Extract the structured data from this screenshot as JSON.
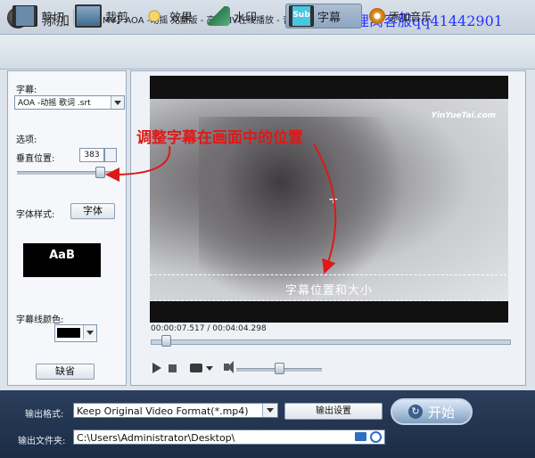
{
  "topbar": {
    "add_label": "添加",
    "file_title": "...\\【MV】AOA -动摇 完整版 - 高清MV在线播放 - 音悦Tai - 让娱乐更美好.MP4",
    "watermark": "狸窝客服qq41442901"
  },
  "tabs": [
    {
      "label": "剪切"
    },
    {
      "label": "裁剪"
    },
    {
      "label": "效果"
    },
    {
      "label": "水印"
    },
    {
      "label": "字幕",
      "active": true
    },
    {
      "label": "添加音乐"
    }
  ],
  "left_panel": {
    "subtitle_label": "字幕:",
    "subtitle_file": "AOA -动摇 歌词 .srt",
    "options_label": "选项:",
    "vertical_pos_label": "垂直位置:",
    "vertical_pos_value": "383",
    "vertical_slider_fraction": 0.88,
    "font_style_label": "字体样式:",
    "font_button": "字体",
    "font_preview": "AaB",
    "outline_color_label": "字幕线颜色:",
    "outline_color": "#000000",
    "default_button": "缺省"
  },
  "preview": {
    "logo": "YinYueTai.com",
    "subtitle_text": "字幕位置和大小",
    "time": "00:00:07.517 / 00:04:04.298",
    "seek_fraction": 0.03,
    "volume_fraction": 0.5
  },
  "annotation": {
    "text": "调整字幕在画面中的位置",
    "color": "#e01818"
  },
  "bottom": {
    "format_label": "输出格式:",
    "format_value": "Keep Original Video Format(*.mp4)",
    "output_settings": "输出设置",
    "start_button": "开始",
    "folder_label": "输出文件夹:",
    "folder_value": "C:\\Users\\Administrator\\Desktop\\"
  }
}
